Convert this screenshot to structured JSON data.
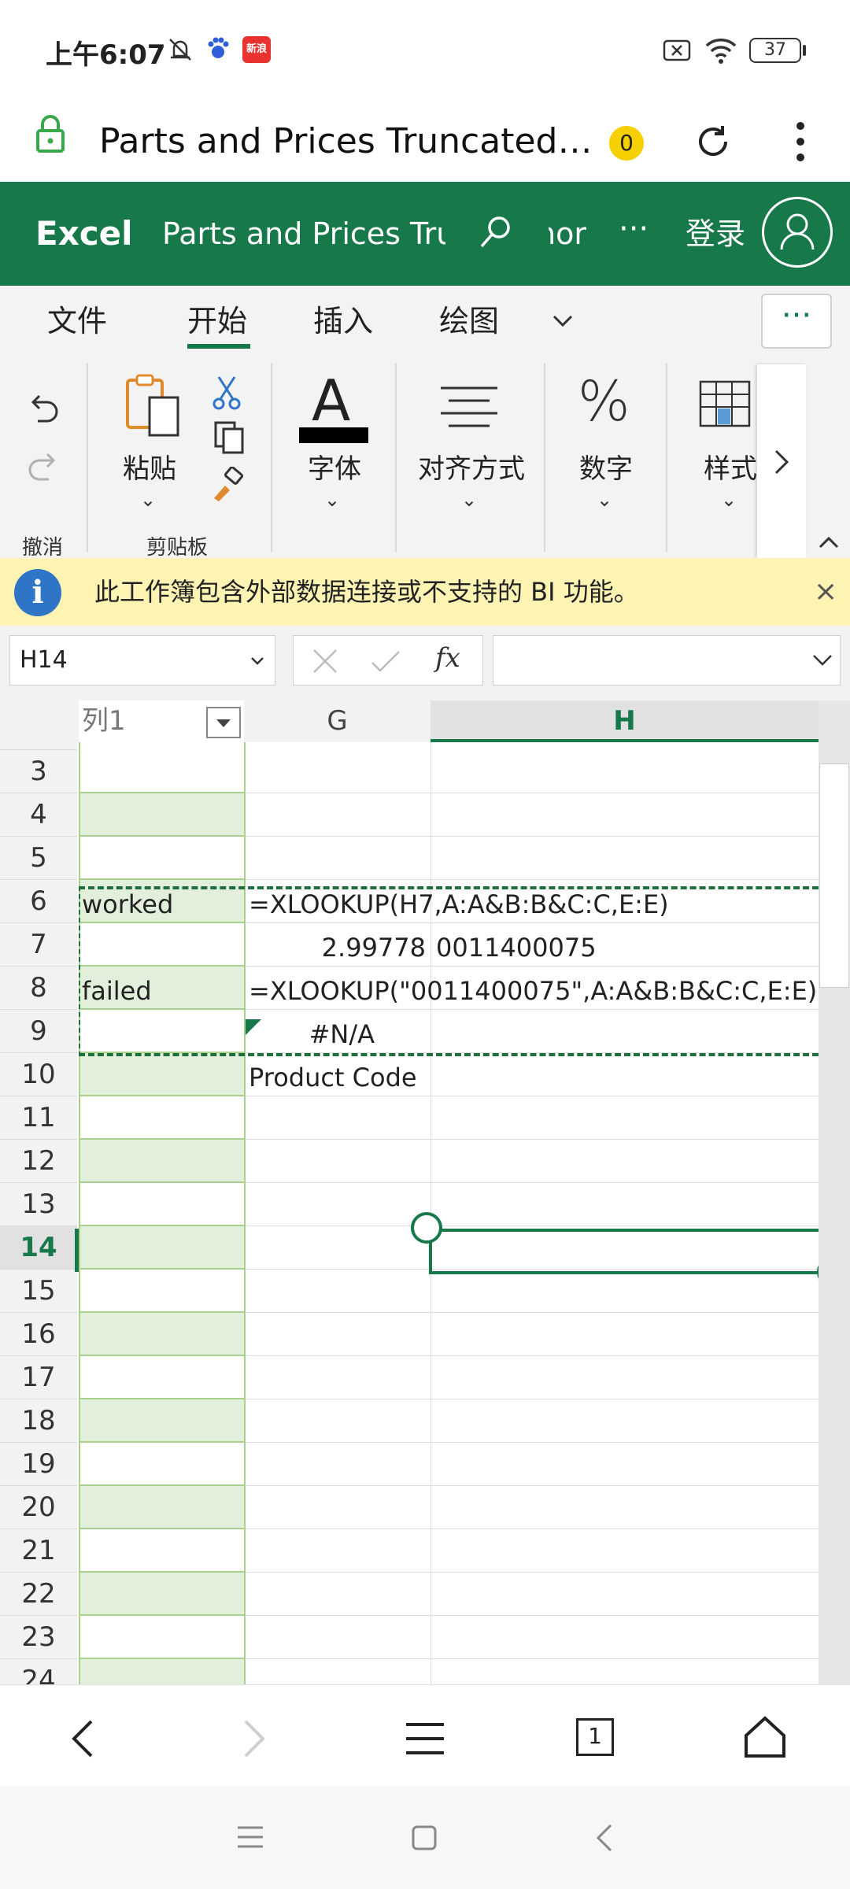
{
  "status_bar": {
    "time": "上午6:07",
    "news_badge": "新浪",
    "battery": "37"
  },
  "browser": {
    "page_title": "Parts and Prices Truncated…",
    "tab_count": "0"
  },
  "excel": {
    "app_name": "Excel",
    "doc_name": "Parts and Prices Truncated",
    "doc_name_overflow": "nor",
    "more": "···",
    "login": "登录"
  },
  "ribbon": {
    "tabs": [
      "文件",
      "开始",
      "插入",
      "绘图"
    ],
    "overflow": "···",
    "undo_label": "撤消",
    "paste_label": "粘贴",
    "clipboard_label": "剪贴板",
    "font_glyph": "A",
    "font_label": "字体",
    "align_label": "对齐方式",
    "number_glyph": "%",
    "number_label": "数字",
    "styles_label": "样式"
  },
  "info_bar": {
    "icon": "i",
    "text": "此工作簿包含外部数据连接或不支持的 BI 功能。",
    "close": "×"
  },
  "formula_bar": {
    "name_box": "H14",
    "fx": "fx",
    "formula": ""
  },
  "grid": {
    "col_headers": {
      "f": "列1",
      "g": "G",
      "h": "H"
    },
    "rows": [
      "3",
      "4",
      "5",
      "6",
      "7",
      "8",
      "9",
      "10",
      "11",
      "12",
      "13",
      "14",
      "15",
      "16",
      "17",
      "18",
      "19",
      "20",
      "21",
      "22",
      "23",
      "24"
    ],
    "cells": {
      "f6": "worked",
      "g6": "=XLOOKUP(H7,A:A&B:B&C:C,E:E)",
      "g7": "2.99778",
      "h7": "0011400075",
      "f8": "failed",
      "g8": "=XLOOKUP(\"0011400075\",A:A&B:B&C:C,E:E)",
      "g9": "#N/A",
      "g10": "Product Code"
    },
    "selected_cell": "H14"
  },
  "colors": {
    "excel_green": "#17784a",
    "table_band": "#e2efda",
    "info_bar": "#fdf3b3"
  }
}
